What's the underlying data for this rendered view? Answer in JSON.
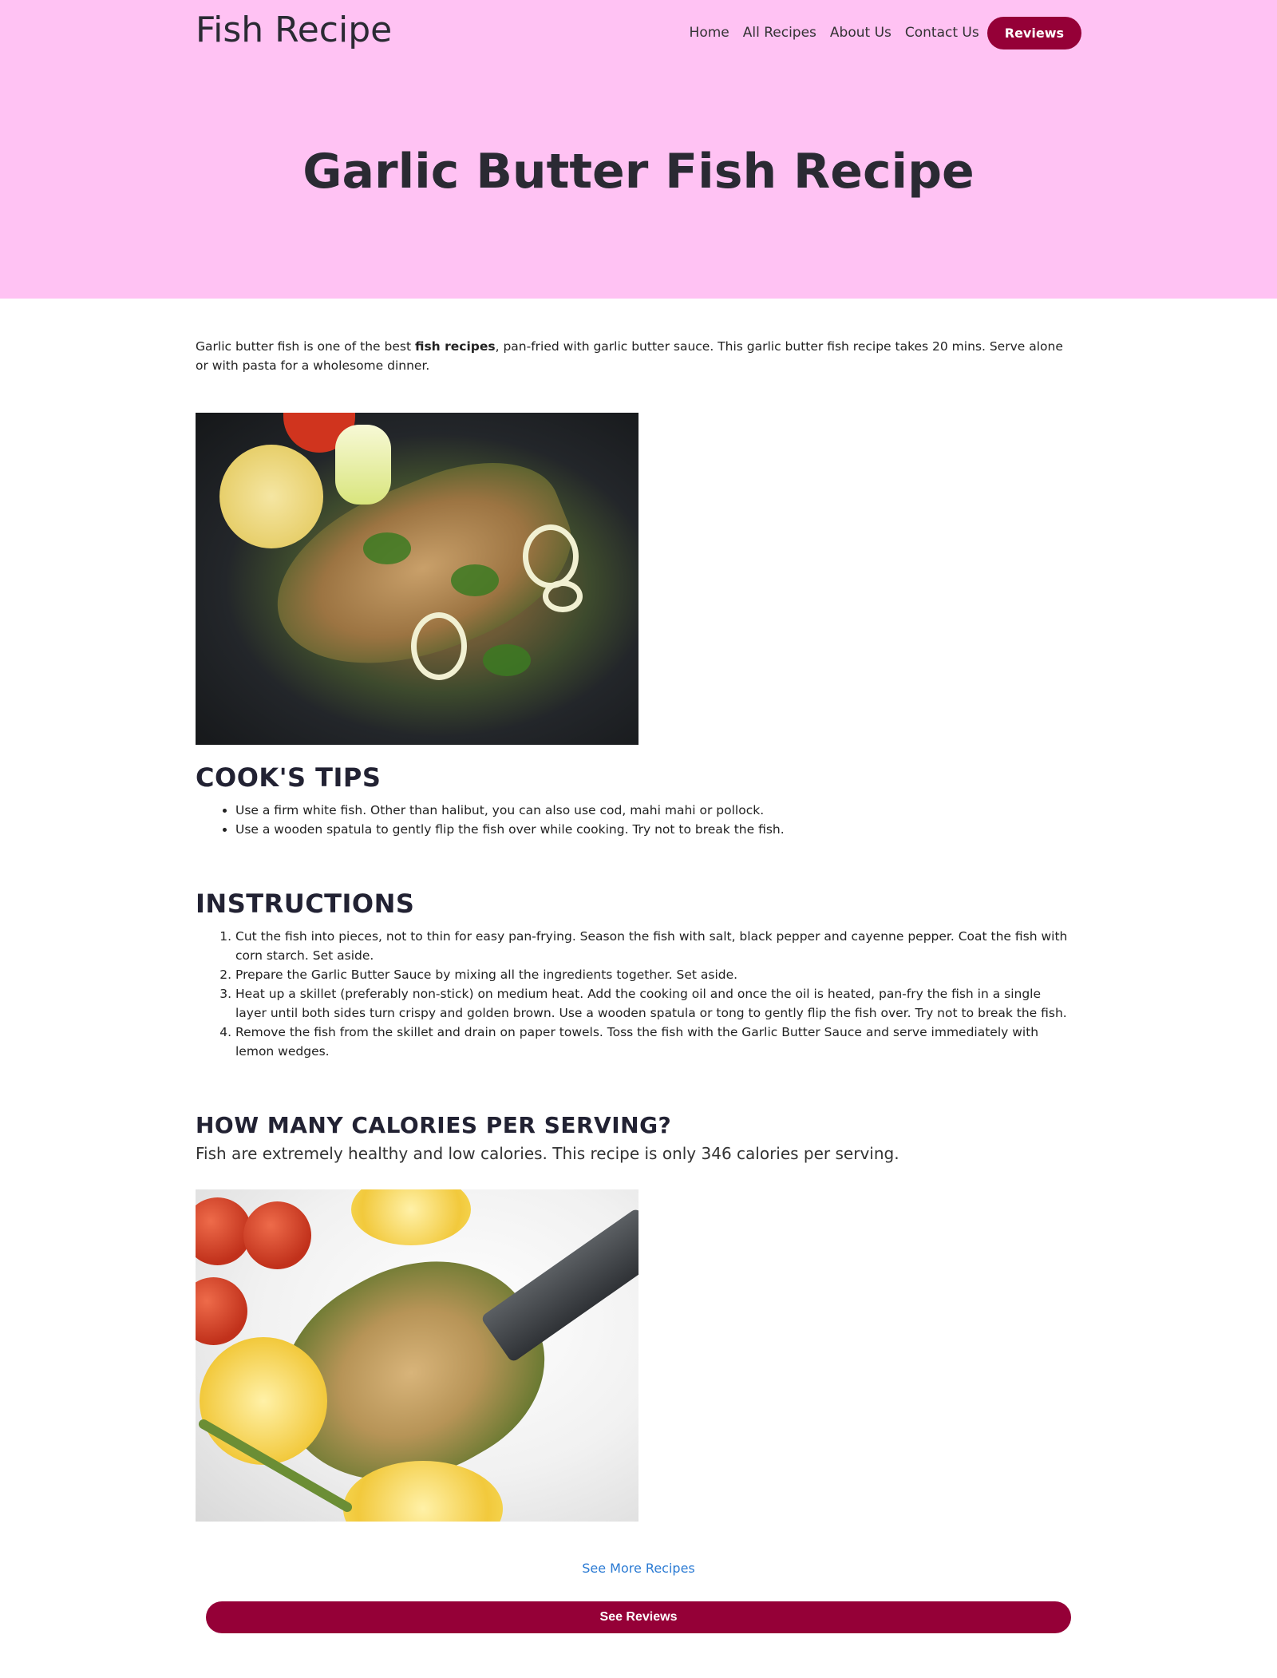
{
  "header": {
    "brand": "Fish Recipe",
    "nav": [
      "Home",
      "All Recipes",
      "About Us",
      "Contact Us"
    ],
    "reviews_button": "Reviews"
  },
  "hero": {
    "title": "Garlic Butter Fish Recipe"
  },
  "intro": {
    "before": "Garlic butter fish is one of the best ",
    "bold": "fish recipes",
    "after": ", pan-fried with garlic butter sauce. This garlic butter fish recipe takes 20 mins. Serve alone or with pasta for a wholesome dinner."
  },
  "tips": {
    "title": "COOK'S TIPS",
    "items": [
      "Use a firm white fish. Other than halibut, you can also use cod, mahi mahi or pollock.",
      "Use a wooden spatula to gently flip the fish over while cooking. Try not to break the fish."
    ]
  },
  "instructions": {
    "title": "INSTRUCTIONS",
    "steps": [
      "Cut the fish into pieces, not to thin for easy pan-frying. Season the fish with salt, black pepper and cayenne pepper. Coat the fish with corn starch. Set aside.",
      "Prepare the Garlic Butter Sauce by mixing all the ingredients together. Set aside.",
      "Heat up a skillet (preferably non-stick) on medium heat. Add the cooking oil and once the oil is heated, pan-fry the fish in a single layer until both sides turn crispy and golden brown. Use a wooden spatula or tong to gently flip the fish over. Try not to break the fish.",
      "Remove the fish from the skillet and drain on paper towels. Toss the fish with the Garlic Butter Sauce and serve immediately with lemon wedges."
    ]
  },
  "calories": {
    "title": "HOW MANY CALORIES PER SERVING?",
    "text": "Fish are extremely healthy and low calories. This recipe is only 346 calories per serving."
  },
  "footer": {
    "more_link": "See More Recipes",
    "reviews_button": "See Reviews"
  },
  "colors": {
    "hero_bg": "#ffc2f3",
    "button_bg": "#950037",
    "link": "#2a7ad3"
  }
}
